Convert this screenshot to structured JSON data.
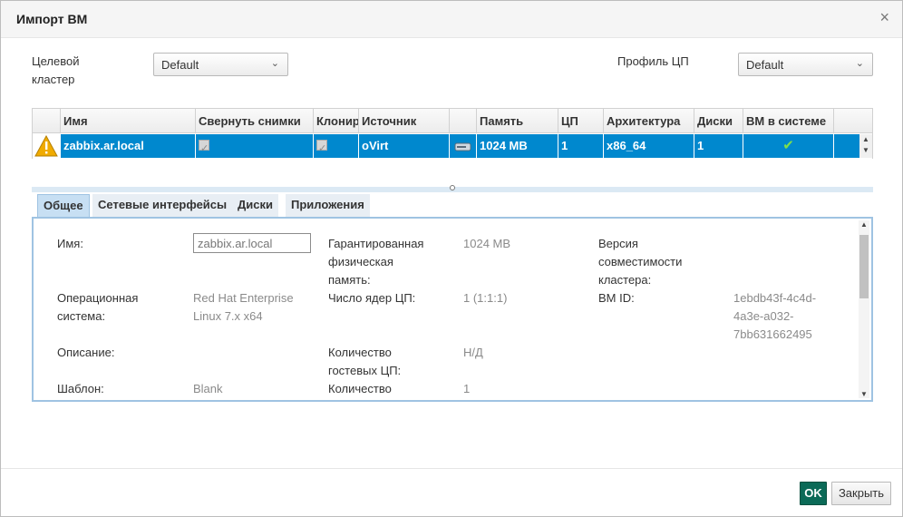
{
  "dialog": {
    "title": "Импорт ВМ",
    "close_glyph": "×"
  },
  "form": {
    "target_cluster_label_line1": "Целевой",
    "target_cluster_label_line2": "кластер",
    "target_cluster_value": "Default",
    "cpu_profile_label": "Профиль ЦП",
    "cpu_profile_value": "Default"
  },
  "grid": {
    "columns": [
      "Имя",
      "Свернуть снимки",
      "Клониро",
      "Источник",
      "",
      "Память",
      "ЦП",
      "Архитектура",
      "Диски",
      "ВМ в системе"
    ],
    "rows": [
      {
        "warning": true,
        "name": "zabbix.ar.local",
        "collapse_snapshots": true,
        "clone": true,
        "source": "oVirt",
        "source_icon": "disk-icon",
        "memory": "1024 MB",
        "cpu": "1",
        "arch": "x86_64",
        "disks": "1",
        "in_system": true
      }
    ]
  },
  "tabs": [
    "Общее",
    "Сетевые интерфейсы",
    "Диски",
    "Приложения"
  ],
  "general": {
    "name_label": "Имя:",
    "name_value": "zabbix.ar.local",
    "os_label_line1": "Операционная",
    "os_label_line2": "система:",
    "os_value_line1": "Red Hat Enterprise",
    "os_value_line2": "Linux 7.x x64",
    "description_label": "Описание:",
    "template_label": "Шаблон:",
    "template_value": "Blank",
    "guaranteed_mem_line1": "Гарантированная",
    "guaranteed_mem_line2": "физическая",
    "guaranteed_mem_line3": "память:",
    "guaranteed_mem_value": "1024 MB",
    "cpu_cores_label": "Число ядер ЦП:",
    "cpu_cores_value": "1 (1:1:1)",
    "guest_cpu_line1": "Количество",
    "guest_cpu_line2": "гостевых ЦП:",
    "guest_cpu_value": "Н/Д",
    "count_label": "Количество",
    "count_value": "1",
    "compat_line1": "Версия",
    "compat_line2": "совместимости",
    "compat_line3": "кластера:",
    "vm_id_label": "ВМ ID:",
    "vm_id_line1": "1ebdb43f-4c4d-",
    "vm_id_line2": "4a3e-a032-",
    "vm_id_line3": "7bb631662495"
  },
  "footer": {
    "ok_label": "OK",
    "close_label": "Закрыть"
  },
  "colors": {
    "selection": "#0088ce",
    "ok_button": "#0b6a57",
    "warning": "#f0ab00",
    "check": "#3f9c35"
  }
}
